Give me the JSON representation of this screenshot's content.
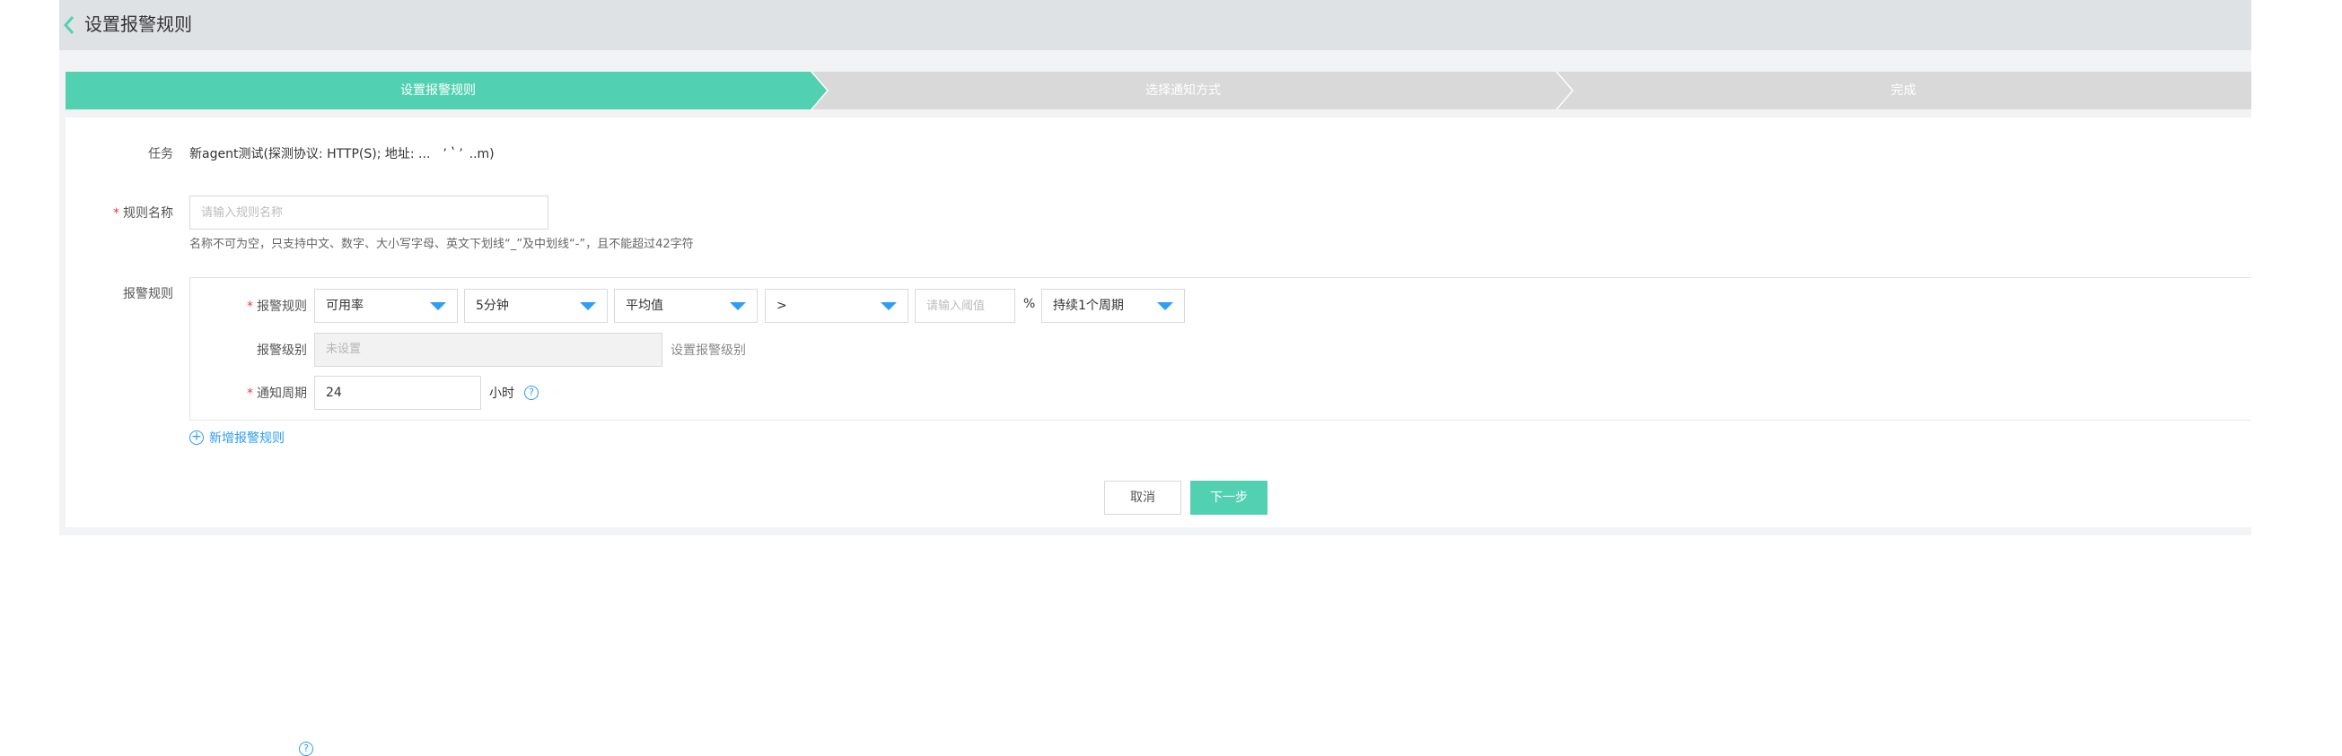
{
  "header": {
    "title": "设置报警规则"
  },
  "steps": [
    {
      "label": "设置报警规则",
      "state": "active"
    },
    {
      "label": "选择通知方式",
      "state": "pending"
    },
    {
      "label": "完成",
      "state": "pending"
    }
  ],
  "form": {
    "task": {
      "label": "任务",
      "value": "新agent测试(探测协议: HTTP(S); 地址: ...  ’ ʽ ’ ..m)"
    },
    "rule_name": {
      "label": "规则名称",
      "placeholder": "请输入规则名称",
      "hint": "名称不可为空，只支持中文、数字、大小写字母、英文下划线“_”及中划线“-”，且不能超过42字符"
    },
    "alarm_rules": {
      "label": "报警规则",
      "rule_row": {
        "label": "报警规则",
        "metric": "可用率",
        "window": "5分钟",
        "aggregation": "平均值",
        "operator": ">",
        "threshold_placeholder": "请输入阈值",
        "unit": "%",
        "duration": "持续1个周期"
      },
      "level_row": {
        "label": "报警级别",
        "value": "未设置",
        "link": "设置报警级别"
      },
      "period_row": {
        "label": "通知周期",
        "value": "24",
        "unit": "小时"
      }
    },
    "add_rule_label": "新增报警规则"
  },
  "buttons": {
    "cancel": "取消",
    "next": "下一步"
  },
  "colors": {
    "accent": "#52d1b2",
    "link": "#2c9ef5",
    "required": "#e84040",
    "step_inactive": "#d9d9d9"
  },
  "icons": [
    "chevron-left-icon",
    "caret-down-icon",
    "help-circle-icon",
    "plus-circle-icon"
  ]
}
